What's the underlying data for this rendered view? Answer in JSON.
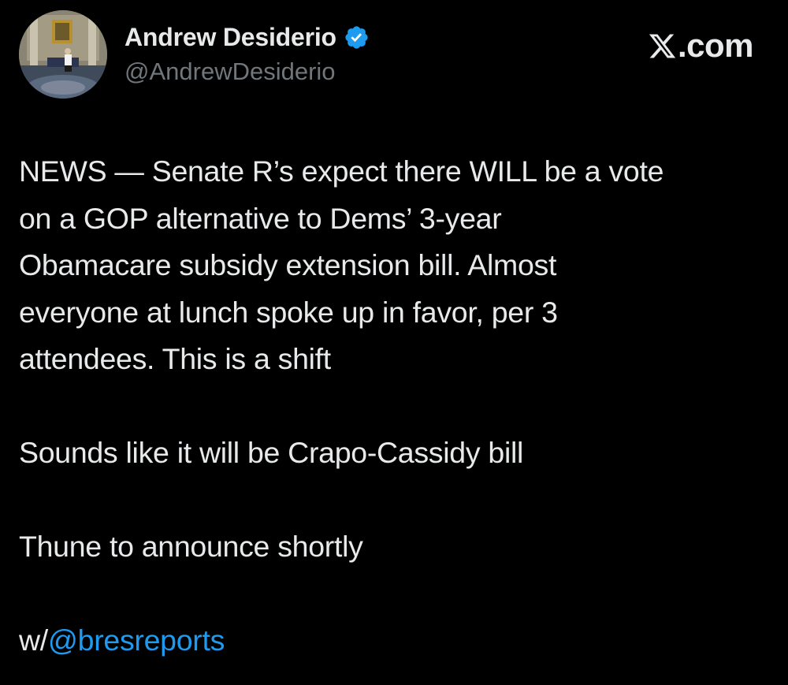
{
  "author": {
    "display_name": "Andrew Desiderio",
    "handle": "@AndrewDesiderio",
    "verified_icon": "verified-badge-icon",
    "badge_color": "#1d9bf0"
  },
  "site": {
    "logo_icon": "x-logo-icon",
    "text": ".com"
  },
  "tweet": {
    "paragraph1": [
      "NEWS — Senate R’s expect there WILL be a vote",
      "on a GOP alternative to Dems’ 3-year",
      "Obamacare subsidy extension bill. Almost",
      "everyone at lunch spoke up in favor, per 3",
      "attendees. This is a shift"
    ],
    "paragraph2": "Sounds like it will be Crapo-Cassidy bill",
    "paragraph3": "Thune to announce shortly",
    "paragraph4_prefix": "w/",
    "paragraph4_mention": "@bresreports"
  },
  "colors": {
    "background": "#000000",
    "text": "#e7e9ea",
    "secondary": "#71767b",
    "link": "#1d9bf0"
  }
}
